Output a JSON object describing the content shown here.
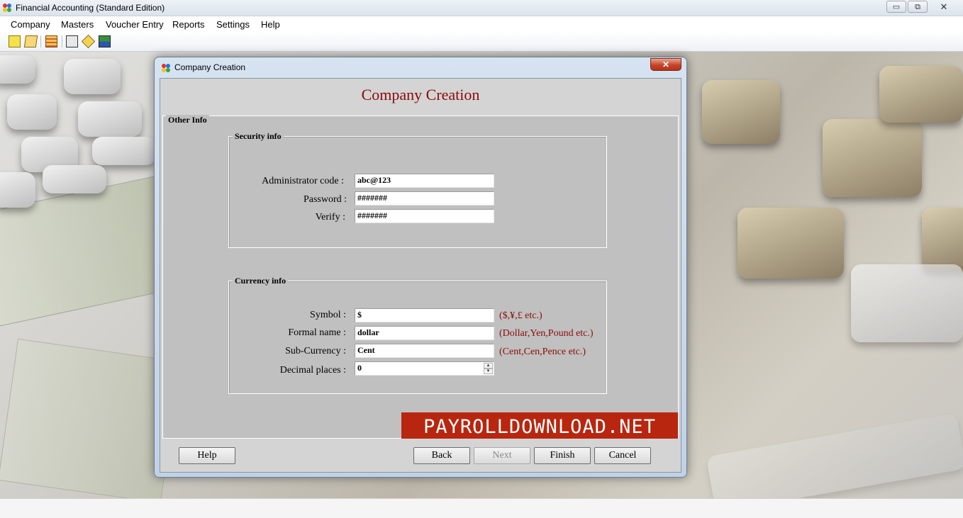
{
  "window": {
    "title": "Financial Accounting (Standard Edition)",
    "min": "▭",
    "restore": "⧉",
    "close": "✕"
  },
  "menu": [
    "Company",
    "Masters",
    "Voucher Entry",
    "Reports",
    "Settings",
    "Help"
  ],
  "toolbar_icons": [
    "new-company-icon",
    "open-company-icon",
    "ledger-icon",
    "voucher-icon",
    "edit-icon",
    "export-icon"
  ],
  "dialog": {
    "title": "Company Creation",
    "close_glyph": "✕",
    "heading": "Company Creation",
    "other_info_label": "Other Info",
    "security": {
      "label": "Security info",
      "admin_code_label": "Administrator code :",
      "admin_code_value": "abc@123",
      "password_label": "Password :",
      "password_value": "#######",
      "verify_label": "Verify :",
      "verify_value": "#######"
    },
    "currency": {
      "label": "Currency info",
      "symbol_label": "Symbol :",
      "symbol_value": "$",
      "symbol_hint": "($,¥,£ etc.)",
      "formal_label": "Formal name :",
      "formal_value": "dollar",
      "formal_hint": "(Dollar,Yen,Pound etc.)",
      "sub_label": "Sub-Currency :",
      "sub_value": "Cent",
      "sub_hint": "(Cent,Cen,Pence etc.)",
      "decimal_label": "Decimal places :",
      "decimal_value": "0"
    },
    "watermark": "PAYROLLDOWNLOAD.NET",
    "buttons": {
      "help": "Help",
      "back": "Back",
      "next": "Next",
      "finish": "Finish",
      "cancel": "Cancel"
    }
  },
  "colors": {
    "heading": "#8b0a0a",
    "hint": "#8b0a0a",
    "watermark_bg": "#b8260f",
    "dialog_frame": "#c8d8ec"
  }
}
